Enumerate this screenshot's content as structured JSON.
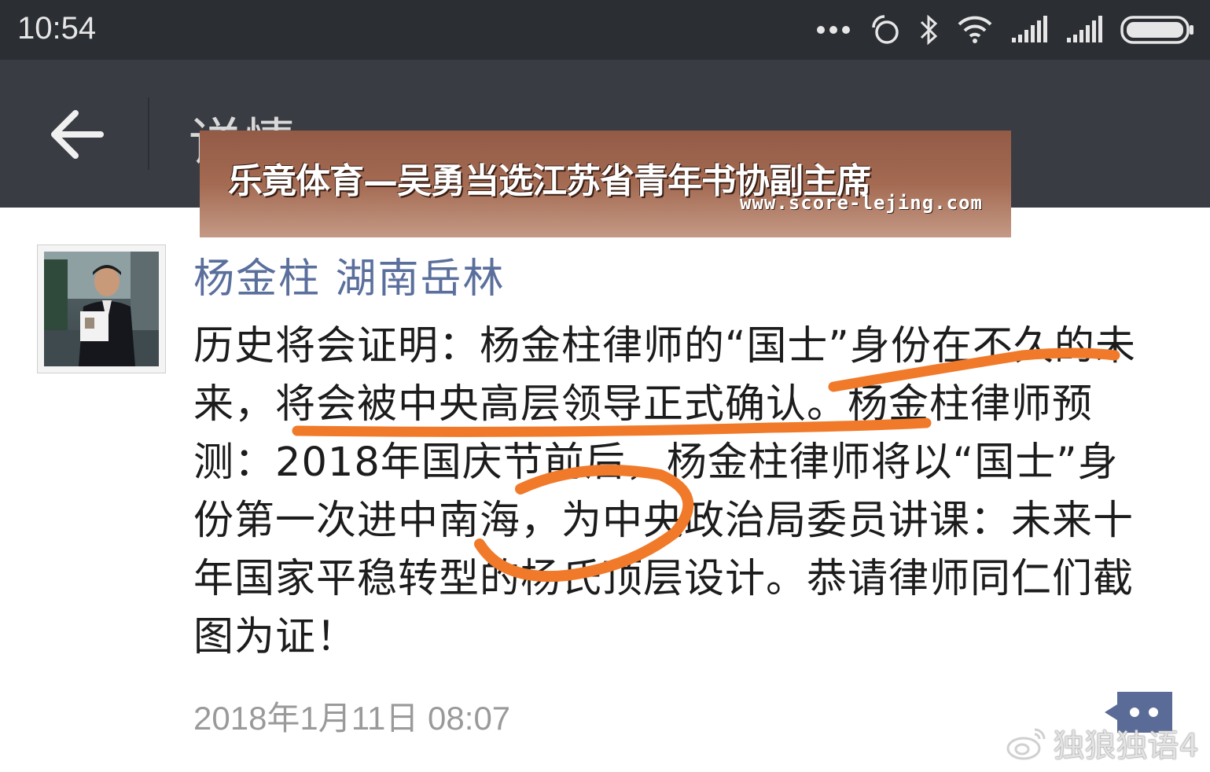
{
  "status_bar": {
    "time": "10:54",
    "icons": [
      "more-dots-icon",
      "data-saver-icon",
      "bluetooth-icon",
      "wifi-icon",
      "signal-icon",
      "signal-icon",
      "battery-icon"
    ]
  },
  "app_bar": {
    "title": "详情",
    "back_icon": "arrow-left-icon"
  },
  "overlay": {
    "title": "乐竟体育—吴勇当选江苏省青年书协副主席",
    "url": "www.score-lejing.com"
  },
  "post": {
    "author": "杨金柱 湖南岳林",
    "text": "历史将会证明：杨金柱律师的“国士”身份在不久的未来，将会被中央高层领导正式确认。杨金柱律师预测：2018年国庆节前后，杨金柱律师将以“国士”身份第一次进中南海，为中央政治局委员讲课：未来十年国家平稳转型的杨氏顶层设计。恭请律师同仁们截图为证！",
    "timestamp": "2018年1月11日 08:07"
  },
  "watermark": "独狼独语4",
  "colors": {
    "status_bar": "#2b2e33",
    "app_bar": "#393c43",
    "author_name": "#5a6f9c",
    "annotation_stroke": "#f07a2a"
  }
}
